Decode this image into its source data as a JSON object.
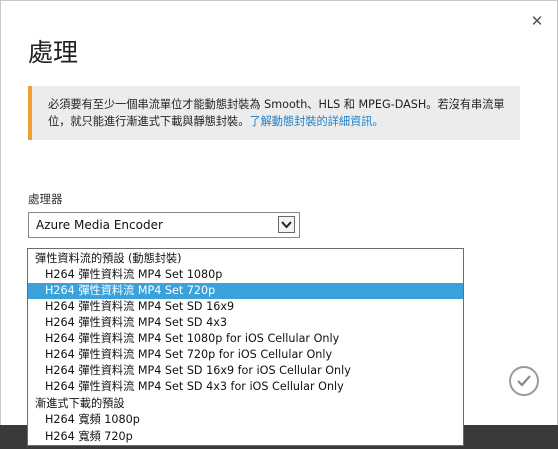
{
  "dialog": {
    "title": "處理",
    "close_label": "✕"
  },
  "notice": {
    "text": "必須要有至少一個串流單位才能動態封裝為 Smooth、HLS 和 MPEG-DASH。若沒有串流單位，就只能進行漸進式下載與靜態封裝。",
    "link": "了解動態封裝的詳細資訊。",
    "accent_color": "#f0a030"
  },
  "processor": {
    "label": "處理器",
    "selected": "Azure Media Encoder"
  },
  "dropdown": {
    "groups": [
      {
        "label": "彈性資料流的預設 (動態封裝)",
        "items": [
          "H264 彈性資料流 MP4 Set 1080p",
          "H264 彈性資料流 MP4 Set 720p",
          "H264 彈性資料流 MP4 Set SD 16x9",
          "H264 彈性資料流 MP4 Set SD 4x3",
          "H264 彈性資料流 MP4 Set 1080p for iOS Cellular Only",
          "H264 彈性資料流 MP4 Set 720p for iOS Cellular Only",
          "H264 彈性資料流 MP4 Set SD 16x9 for iOS Cellular Only",
          "H264 彈性資料流 MP4 Set SD 4x3 for iOS Cellular Only"
        ]
      },
      {
        "label": "漸進式下載的預設",
        "items": [
          "H264 寬頻 1080p",
          "H264 寬頻 720p"
        ]
      }
    ],
    "selected_item": "H264 彈性資料流 MP4 Set 720p",
    "highlight_color": "#3aa1da"
  },
  "actions": {
    "confirm_icon": "check-icon"
  }
}
